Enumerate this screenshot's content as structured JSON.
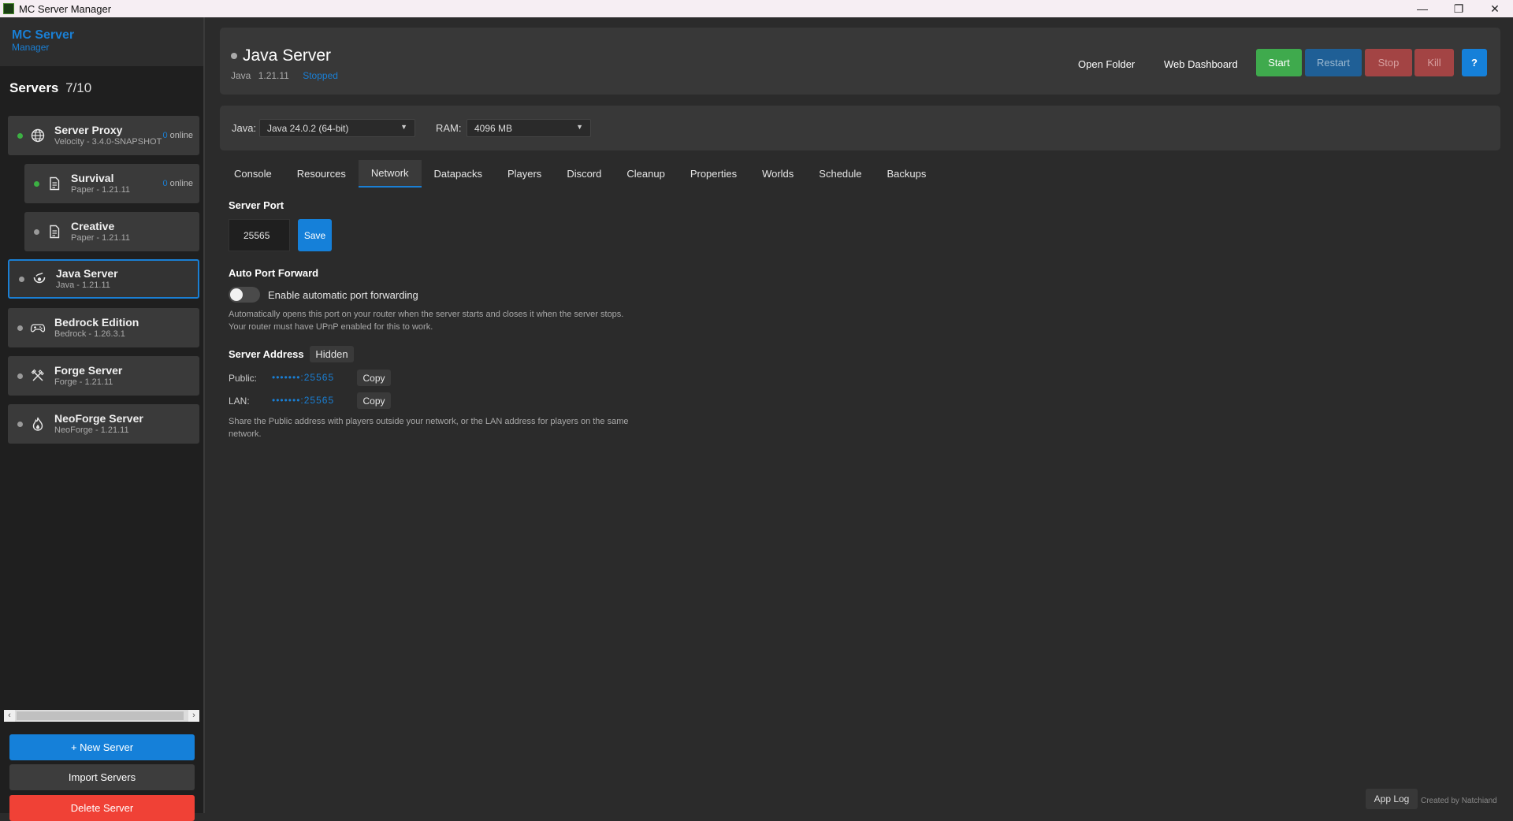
{
  "window": {
    "title": "MC Server Manager",
    "controls": [
      "—",
      "❐",
      "✕"
    ]
  },
  "sidebar": {
    "brand_line1": "MC Server",
    "brand_line2": "Manager",
    "servers_label": "Servers",
    "servers_count": "7/10",
    "servers": [
      {
        "name": "Server Proxy",
        "sub": "Velocity - 3.4.0-SNAPSHOT",
        "online_n": "0",
        "online_label": " online",
        "status": "online",
        "icon": "globe-icon"
      },
      {
        "name": "Survival",
        "sub": "Paper - 1.21.11",
        "online_n": "0",
        "online_label": " online",
        "status": "online",
        "icon": "document-icon"
      },
      {
        "name": "Creative",
        "sub": "Paper - 1.21.11",
        "status": "offline",
        "icon": "document-icon"
      },
      {
        "name": "Java Server",
        "sub": "Java - 1.21.11",
        "status": "offline",
        "icon": "java-icon"
      },
      {
        "name": "Bedrock Edition",
        "sub": "Bedrock - 1.26.3.1",
        "status": "offline",
        "icon": "gamepad-icon"
      },
      {
        "name": "Forge Server",
        "sub": "Forge - 1.21.11",
        "status": "offline",
        "icon": "tools-icon"
      },
      {
        "name": "NeoForge Server",
        "sub": "NeoForge - 1.21.11",
        "status": "offline",
        "icon": "flame-icon"
      }
    ],
    "new_server": "+ New Server",
    "import_servers": "Import Servers",
    "delete_server": "Delete Server"
  },
  "header": {
    "title": "Java Server",
    "type": "Java",
    "version": "1.21.11",
    "status": "Stopped",
    "open_folder": "Open Folder",
    "web_dashboard": "Web Dashboard",
    "start": "Start",
    "restart": "Restart",
    "stop": "Stop",
    "kill": "Kill",
    "help": "?"
  },
  "config": {
    "java_label": "Java:",
    "java_value": "Java 24.0.2 (64-bit)",
    "ram_label": "RAM:",
    "ram_value": "4096 MB"
  },
  "tabs": [
    "Console",
    "Resources",
    "Network",
    "Datapacks",
    "Players",
    "Discord",
    "Cleanup",
    "Properties",
    "Worlds",
    "Schedule",
    "Backups"
  ],
  "active_tab": "Network",
  "network": {
    "port_title": "Server Port",
    "port_value": "25565",
    "save": "Save",
    "forward_title": "Auto Port Forward",
    "forward_toggle_label": "Enable automatic port forwarding",
    "forward_enabled": false,
    "forward_help": "Automatically opens this port on your router when the server starts and closes it when the server stops. Your router must have UPnP enabled for this to work.",
    "address_title": "Server Address",
    "hidden_btn": "Hidden",
    "public_label": "Public:",
    "public_value": "•••••••:25565",
    "lan_label": "LAN:",
    "lan_value": "•••••••:25565",
    "copy": "Copy",
    "address_help": "Share the Public address with players outside your network, or the LAN address for players on the same network."
  },
  "footer": {
    "app_log": "App Log",
    "credit": "Created by Natchiand"
  },
  "colors": {
    "accent": "#1a7fd4",
    "start": "#3faa4d",
    "danger": "#f04136",
    "online": "#3cb043"
  }
}
